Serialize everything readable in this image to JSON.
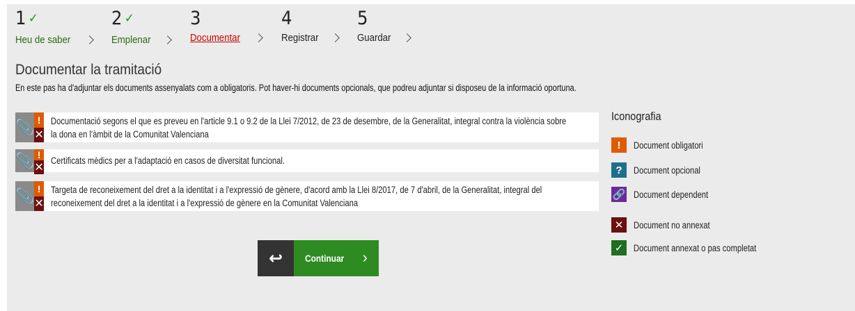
{
  "stepper": {
    "steps": [
      {
        "number": "1",
        "label": "Heu de saber",
        "state": "done"
      },
      {
        "number": "2",
        "label": "Emplenar",
        "state": "done"
      },
      {
        "number": "3",
        "label": "Documentar",
        "state": "current"
      },
      {
        "number": "4",
        "label": "Registrar",
        "state": "pending"
      },
      {
        "number": "5",
        "label": "Guardar",
        "state": "pending"
      }
    ]
  },
  "page": {
    "title": "Documentar la tramitació",
    "intro": "En este pas ha d'adjuntar els documents assenyalats com a obligatoris. Pot haver-hi documents opcionals, que podreu adjuntar si disposeu de la informació oportuna."
  },
  "documents": [
    {
      "text": "Documentació segons el que es preveu en l'article 9.1 o 9.2 de la Llei 7/2012, de 23 de desembre, de la Generalitat, integral contra la violència sobre la dona en l'àmbit de la Comunitat Valenciana",
      "type": "obligatori",
      "status": "no annexat"
    },
    {
      "text": "Certificats mèdics per a l'adaptació en casos de diversitat funcional.",
      "type": "obligatori",
      "status": "no annexat"
    },
    {
      "text": "Targeta de reconeixement del dret a la identitat i a l'expressió de gènere, d'acord amb la Llei 8/2017, de 7 d'abril, de la Generalitat, integral del reconeixement del dret a la identitat i a l'expressió de gènere en la Comunitat Valenciana",
      "type": "obligatori",
      "status": "no annexat"
    }
  ],
  "actions": {
    "continue_label": "Continuar"
  },
  "legend": {
    "title": "Iconografia",
    "items": [
      {
        "icon": "exclamation-icon",
        "label": "Document obligatori",
        "color": "#e05a00"
      },
      {
        "icon": "question-icon",
        "label": "Document opcional",
        "color": "#1e6f8c"
      },
      {
        "icon": "link-icon",
        "label": "Document dependent",
        "color": "#6b2b9b"
      },
      {
        "icon": "x-icon",
        "label": "Document no annexat",
        "color": "#6b0f0f"
      },
      {
        "icon": "check-icon",
        "label": "Document annexat o pas completat",
        "color": "#1f6f1f"
      }
    ]
  }
}
